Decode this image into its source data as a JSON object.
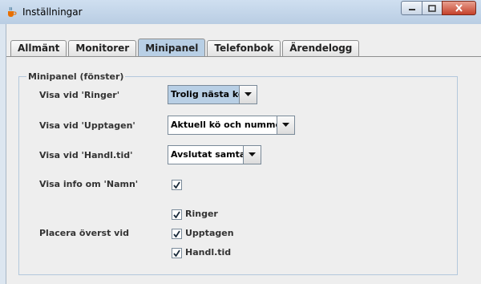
{
  "window": {
    "title": "Inställningar",
    "icon": "java-cup-icon"
  },
  "titlebar_buttons": {
    "minimize_icon": "minimize-icon",
    "maximize_icon": "maximize-icon",
    "close_icon": "close-icon"
  },
  "tabs": [
    {
      "label": "Allmänt",
      "active": false
    },
    {
      "label": "Monitorer",
      "active": false
    },
    {
      "label": "Minipanel",
      "active": true
    },
    {
      "label": "Telefonbok",
      "active": false
    },
    {
      "label": "Ärendelogg",
      "active": false
    }
  ],
  "group": {
    "title": "Minipanel (fönster)"
  },
  "fields": {
    "ringer": {
      "label": "Visa vid 'Ringer'",
      "value": "Trolig nästa kö"
    },
    "upptagen": {
      "label": "Visa vid 'Upptagen'",
      "value": "Aktuell kö och nummer"
    },
    "handltid": {
      "label": "Visa vid 'Handl.tid'",
      "value": "Avslutat samtal"
    },
    "info_namn": {
      "label": "Visa info om 'Namn'",
      "checked": true
    },
    "placera": {
      "label": "Placera överst vid",
      "options": [
        {
          "label": "Ringer",
          "checked": true
        },
        {
          "label": "Upptagen",
          "checked": true
        },
        {
          "label": "Handl.tid",
          "checked": true
        }
      ]
    }
  },
  "colors": {
    "accent": "#b8cfe5",
    "titlebar": "#c4d6ea",
    "close": "#c5412b"
  }
}
